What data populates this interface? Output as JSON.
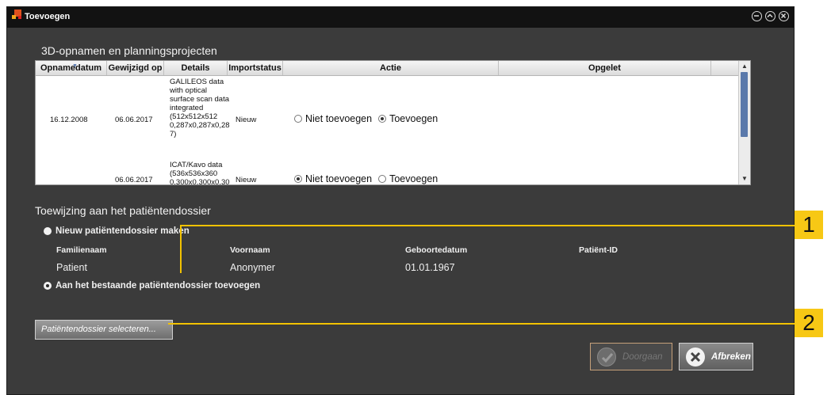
{
  "window": {
    "title": "Toevoegen",
    "controls": [
      "minimize-icon",
      "maximize-icon",
      "close-icon"
    ]
  },
  "recordings": {
    "title": "3D-opnamen en planningsprojecten",
    "columns": [
      "Opnamedatum",
      "Gewijzigd op",
      "Details",
      "Importstatus",
      "Actie",
      "Opgelet"
    ],
    "rows": [
      {
        "date": "16.12.2008",
        "modified": "06.06.2017",
        "details": "GALILEOS data\nwith optical\nsurface scan data\nintegrated\n(512x512x512\n0,287x0,287x0,28\n7)",
        "status": "Nieuw",
        "option_skip": "Niet toevoegen",
        "option_add": "Toevoegen",
        "selected": "add"
      },
      {
        "date": "",
        "modified": "06.06.2017",
        "details": "ICAT/Kavo data\n(536x536x360\n0,300x0,300x0,30",
        "status": "Nieuw",
        "option_skip": "Niet toevoegen",
        "option_add": "Toevoegen",
        "selected": "skip"
      }
    ]
  },
  "assignment": {
    "title": "Toewijzing aan het patiëntendossier",
    "option_new": "Nieuw patiëntendossier maken",
    "option_existing": "Aan het bestaande patiëntendossier toevoegen",
    "selected": "existing",
    "labels": {
      "family_name": "Familienaam",
      "first_name": "Voornaam",
      "birth_date": "Geboortedatum",
      "patient_id": "Patiënt-ID"
    },
    "patient": {
      "family_name": "Patient",
      "first_name": "Anonymer",
      "birth_date": "01.01.1967",
      "patient_id": ""
    },
    "select_button": "Patiëntendossier selecteren..."
  },
  "buttons": {
    "continue": "Doorgaan",
    "continue_enabled": false,
    "cancel": "Afbreken"
  },
  "callouts": [
    "1",
    "2"
  ],
  "colors": {
    "background": "#3b3b3b",
    "titlebar": "#121212",
    "callout": "#f7c815",
    "scroll_thumb": "#5a79ab"
  }
}
